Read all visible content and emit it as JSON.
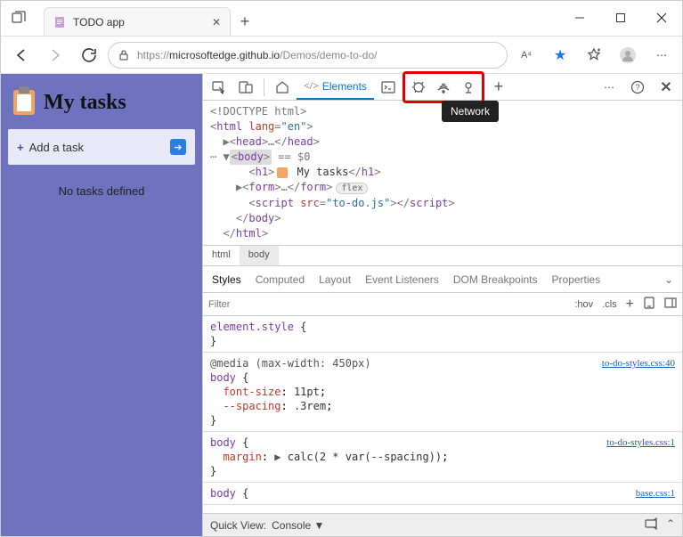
{
  "browser": {
    "tab_title": "TODO app",
    "url_protocol": "https://",
    "url_host": "microsoftedge.github.io",
    "url_path": "/Demos/demo-to-do/",
    "aa_label": "A⁴"
  },
  "page": {
    "title": "My tasks",
    "add_task": "Add a task",
    "no_tasks": "No tasks defined"
  },
  "devtools": {
    "elements_tab": "Elements",
    "tooltip": "Network",
    "dom": {
      "doctype": "<!DOCTYPE html>",
      "html_open": "html",
      "html_lang_attr": "lang",
      "html_lang_val": "\"en\"",
      "head": "head",
      "body": "body",
      "body_meta": " == $0",
      "h1": "h1",
      "h1_text": " My tasks",
      "form": "form",
      "flex_badge": "flex",
      "script": "script",
      "script_src_attr": "src",
      "script_src_val": "\"to-do.js\""
    },
    "crumb_html": "html",
    "crumb_body": "body",
    "styles_tabs": {
      "styles": "Styles",
      "computed": "Computed",
      "layout": "Layout",
      "event": "Event Listeners",
      "dom_bp": "DOM Breakpoints",
      "props": "Properties"
    },
    "filter_placeholder": "Filter",
    "filter_hov": ":hov",
    "filter_cls": ".cls",
    "rules": {
      "element_style": "element.style",
      "media": "@media (max-width: 450px)",
      "body_sel": "body",
      "font_size_prop": "font-size",
      "font_size_val": "11pt",
      "spacing_prop": "--spacing",
      "spacing_val": ".3rem",
      "link1": "to-do-styles.css:40",
      "margin_prop": "margin",
      "margin_val": "calc(2 * var(--spacing))",
      "link2": "to-do-styles.css:1",
      "link3": "base.css:1"
    },
    "quickview_label": "Quick View:",
    "quickview_val": "Console"
  }
}
